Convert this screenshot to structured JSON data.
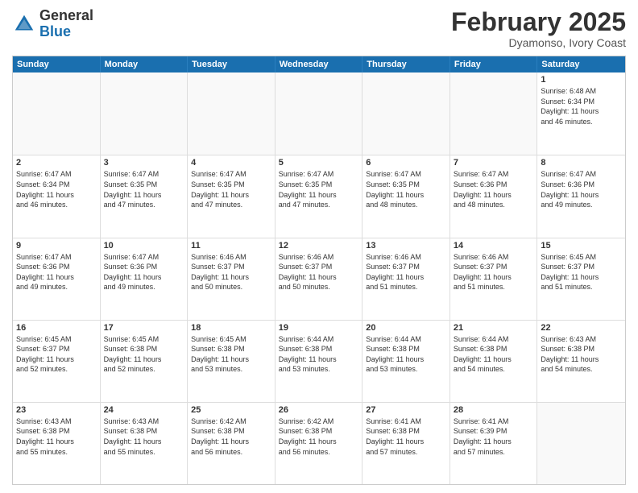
{
  "logo": {
    "general": "General",
    "blue": "Blue"
  },
  "header": {
    "month": "February 2025",
    "location": "Dyamonso, Ivory Coast"
  },
  "weekdays": [
    "Sunday",
    "Monday",
    "Tuesday",
    "Wednesday",
    "Thursday",
    "Friday",
    "Saturday"
  ],
  "weeks": [
    [
      {
        "day": "",
        "info": ""
      },
      {
        "day": "",
        "info": ""
      },
      {
        "day": "",
        "info": ""
      },
      {
        "day": "",
        "info": ""
      },
      {
        "day": "",
        "info": ""
      },
      {
        "day": "",
        "info": ""
      },
      {
        "day": "1",
        "info": "Sunrise: 6:48 AM\nSunset: 6:34 PM\nDaylight: 11 hours\nand 46 minutes."
      }
    ],
    [
      {
        "day": "2",
        "info": "Sunrise: 6:47 AM\nSunset: 6:34 PM\nDaylight: 11 hours\nand 46 minutes."
      },
      {
        "day": "3",
        "info": "Sunrise: 6:47 AM\nSunset: 6:35 PM\nDaylight: 11 hours\nand 47 minutes."
      },
      {
        "day": "4",
        "info": "Sunrise: 6:47 AM\nSunset: 6:35 PM\nDaylight: 11 hours\nand 47 minutes."
      },
      {
        "day": "5",
        "info": "Sunrise: 6:47 AM\nSunset: 6:35 PM\nDaylight: 11 hours\nand 47 minutes."
      },
      {
        "day": "6",
        "info": "Sunrise: 6:47 AM\nSunset: 6:35 PM\nDaylight: 11 hours\nand 48 minutes."
      },
      {
        "day": "7",
        "info": "Sunrise: 6:47 AM\nSunset: 6:36 PM\nDaylight: 11 hours\nand 48 minutes."
      },
      {
        "day": "8",
        "info": "Sunrise: 6:47 AM\nSunset: 6:36 PM\nDaylight: 11 hours\nand 49 minutes."
      }
    ],
    [
      {
        "day": "9",
        "info": "Sunrise: 6:47 AM\nSunset: 6:36 PM\nDaylight: 11 hours\nand 49 minutes."
      },
      {
        "day": "10",
        "info": "Sunrise: 6:47 AM\nSunset: 6:36 PM\nDaylight: 11 hours\nand 49 minutes."
      },
      {
        "day": "11",
        "info": "Sunrise: 6:46 AM\nSunset: 6:37 PM\nDaylight: 11 hours\nand 50 minutes."
      },
      {
        "day": "12",
        "info": "Sunrise: 6:46 AM\nSunset: 6:37 PM\nDaylight: 11 hours\nand 50 minutes."
      },
      {
        "day": "13",
        "info": "Sunrise: 6:46 AM\nSunset: 6:37 PM\nDaylight: 11 hours\nand 51 minutes."
      },
      {
        "day": "14",
        "info": "Sunrise: 6:46 AM\nSunset: 6:37 PM\nDaylight: 11 hours\nand 51 minutes."
      },
      {
        "day": "15",
        "info": "Sunrise: 6:45 AM\nSunset: 6:37 PM\nDaylight: 11 hours\nand 51 minutes."
      }
    ],
    [
      {
        "day": "16",
        "info": "Sunrise: 6:45 AM\nSunset: 6:37 PM\nDaylight: 11 hours\nand 52 minutes."
      },
      {
        "day": "17",
        "info": "Sunrise: 6:45 AM\nSunset: 6:38 PM\nDaylight: 11 hours\nand 52 minutes."
      },
      {
        "day": "18",
        "info": "Sunrise: 6:45 AM\nSunset: 6:38 PM\nDaylight: 11 hours\nand 53 minutes."
      },
      {
        "day": "19",
        "info": "Sunrise: 6:44 AM\nSunset: 6:38 PM\nDaylight: 11 hours\nand 53 minutes."
      },
      {
        "day": "20",
        "info": "Sunrise: 6:44 AM\nSunset: 6:38 PM\nDaylight: 11 hours\nand 53 minutes."
      },
      {
        "day": "21",
        "info": "Sunrise: 6:44 AM\nSunset: 6:38 PM\nDaylight: 11 hours\nand 54 minutes."
      },
      {
        "day": "22",
        "info": "Sunrise: 6:43 AM\nSunset: 6:38 PM\nDaylight: 11 hours\nand 54 minutes."
      }
    ],
    [
      {
        "day": "23",
        "info": "Sunrise: 6:43 AM\nSunset: 6:38 PM\nDaylight: 11 hours\nand 55 minutes."
      },
      {
        "day": "24",
        "info": "Sunrise: 6:43 AM\nSunset: 6:38 PM\nDaylight: 11 hours\nand 55 minutes."
      },
      {
        "day": "25",
        "info": "Sunrise: 6:42 AM\nSunset: 6:38 PM\nDaylight: 11 hours\nand 56 minutes."
      },
      {
        "day": "26",
        "info": "Sunrise: 6:42 AM\nSunset: 6:38 PM\nDaylight: 11 hours\nand 56 minutes."
      },
      {
        "day": "27",
        "info": "Sunrise: 6:41 AM\nSunset: 6:38 PM\nDaylight: 11 hours\nand 57 minutes."
      },
      {
        "day": "28",
        "info": "Sunrise: 6:41 AM\nSunset: 6:39 PM\nDaylight: 11 hours\nand 57 minutes."
      },
      {
        "day": "",
        "info": ""
      }
    ]
  ]
}
